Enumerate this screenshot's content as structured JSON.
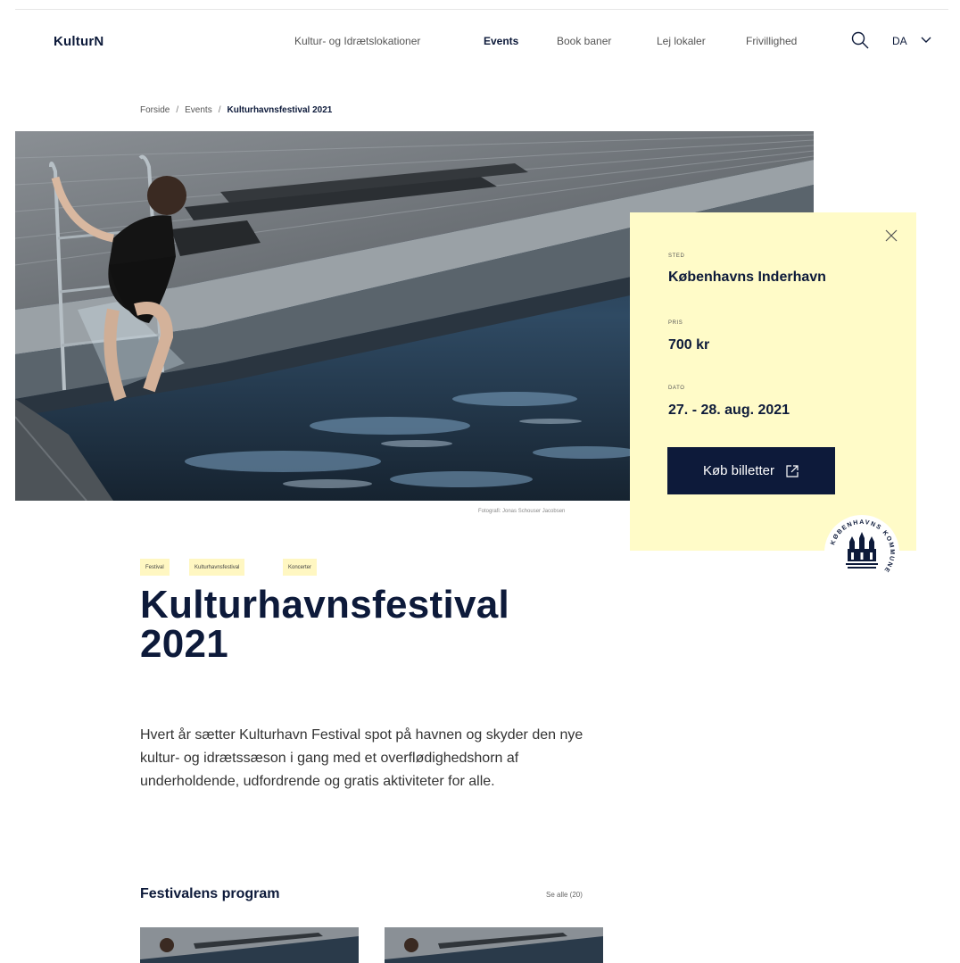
{
  "header": {
    "logo": "KulturN",
    "nav": [
      {
        "label": "Kultur- og Idrætslokationer"
      },
      {
        "label": "Events"
      },
      {
        "label": "Book baner"
      },
      {
        "label": "Lej lokaler"
      },
      {
        "label": "Frivillighed"
      }
    ],
    "active_nav": "Events",
    "search_icon": "search-icon",
    "language": "DA"
  },
  "breadcrumb": {
    "items": [
      "Forside",
      "Events",
      "Kulturhavnsfestival 2021"
    ],
    "separator": "/"
  },
  "hero": {
    "photo_credit": "Fotografi: Jonas Schouser Jacobsen"
  },
  "info_card": {
    "place_label": "STED",
    "place": "Københavns Inderhavn",
    "price_label": "PRIS",
    "price": "700 kr",
    "date_label": "DATO",
    "date": "27. - 28. aug. 2021",
    "buy_label": "Køb billetter",
    "bg_color": "#fffbc8",
    "seal_text": "KØBENHAVNS KOMMUNE"
  },
  "tags": [
    "Festival",
    "Kulturhavnsfestival",
    "Koncerter"
  ],
  "title_line1": "Kulturhavnsfestival",
  "title_line2": "2021",
  "intro": "Hvert år sætter Kulturhavn Festival spot på havnen og skyder den nye kultur- og idrætssæson i gang med et overflødighedshorn af underholdende, udfordrende og gratis aktiviteter for alle.",
  "program": {
    "title": "Festivalens program",
    "see_all": "Se alle (20)"
  },
  "colors": {
    "navy": "#0d1a3a",
    "card_yellow": "#fffbc8",
    "tag_yellow": "#fff7c2"
  }
}
